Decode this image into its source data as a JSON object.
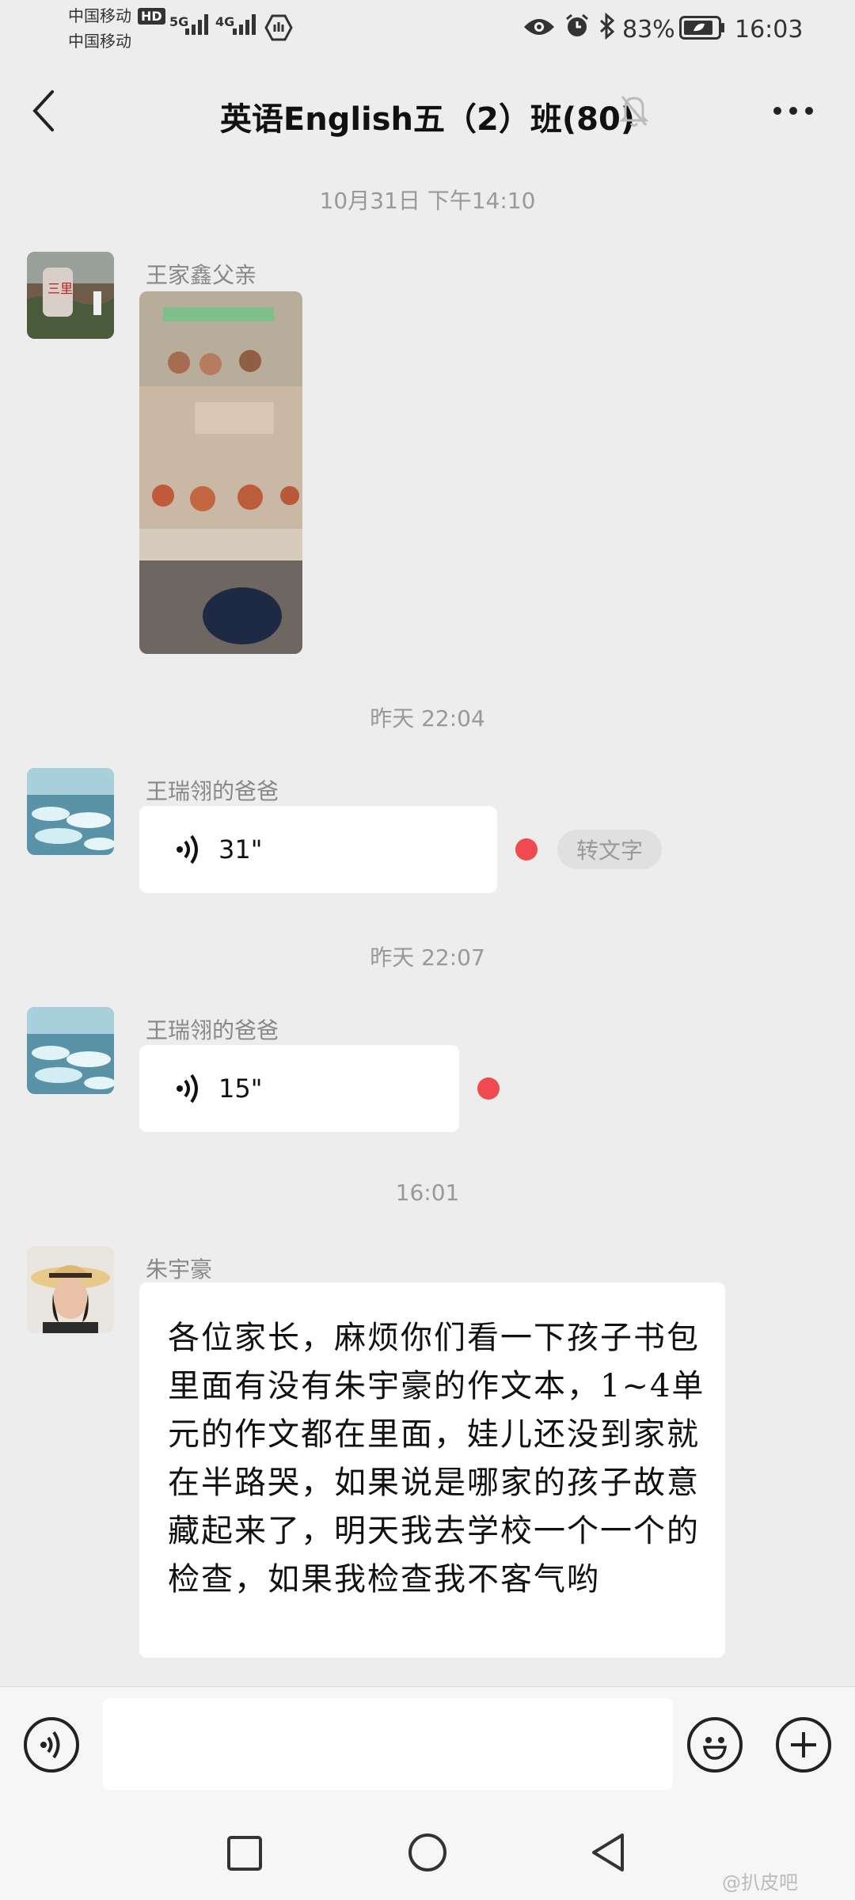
{
  "status_bar": {
    "carrier_1": "中国移动",
    "carrier_2": "中国移动",
    "hd_badge": "HD",
    "net_1": "5G",
    "net_2": "4G",
    "battery": "83%",
    "time": "16:03"
  },
  "header": {
    "title": "英语English五（2）班(80)"
  },
  "messages": [
    {
      "type": "timestamp",
      "text": "10月31日 下午14:10"
    },
    {
      "type": "image",
      "sender": "王家鑫父亲"
    },
    {
      "type": "timestamp",
      "text": "昨天 22:04"
    },
    {
      "type": "voice",
      "sender": "王瑞翎的爸爸",
      "duration": "31\"",
      "action": "转文字"
    },
    {
      "type": "timestamp",
      "text": "昨天 22:07"
    },
    {
      "type": "voice",
      "sender": "王瑞翎的爸爸",
      "duration": "15\""
    },
    {
      "type": "timestamp",
      "text": "16:01"
    },
    {
      "type": "text",
      "sender": "朱宇豪",
      "text": "各位家长，麻烦你们看一下孩子书包里面有没有朱宇豪的作文本，1~4单元的作文都在里面，娃儿还没到家就在半路哭，如果说是哪家的孩子故意藏起来了，明天我去学校一个一个的检查，如果我检查我不客气哟"
    }
  ],
  "watermark": "@扒皮吧",
  "colors": {
    "background": "#ededed",
    "bubble": "#ffffff",
    "unread_dot": "#ef4a4f"
  }
}
